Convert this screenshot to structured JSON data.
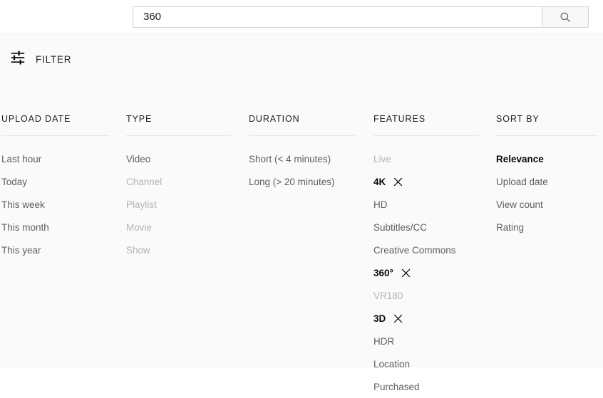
{
  "search": {
    "value": "360",
    "placeholder": "Search",
    "button_label": "Search",
    "icon": "search-icon"
  },
  "filter_bar": {
    "label": "FILTER",
    "icon": "tune-icon"
  },
  "colors": {
    "page_background": "#ffffff",
    "panel_background": "#fafafa",
    "text_default": "#606060",
    "text_selected": "#0a0a0a",
    "text_disabled": "#b4b4b4",
    "divider": "#e8e8e8",
    "input_border": "#d3d3d3",
    "button_background": "#f8f8f8"
  },
  "columns": [
    {
      "header": "UPLOAD DATE",
      "items": [
        {
          "label": "Last hour",
          "state": "default",
          "clearable": false
        },
        {
          "label": "Today",
          "state": "default",
          "clearable": false
        },
        {
          "label": "This week",
          "state": "default",
          "clearable": false
        },
        {
          "label": "This month",
          "state": "default",
          "clearable": false
        },
        {
          "label": "This year",
          "state": "default",
          "clearable": false
        }
      ]
    },
    {
      "header": "TYPE",
      "items": [
        {
          "label": "Video",
          "state": "default",
          "clearable": false
        },
        {
          "label": "Channel",
          "state": "disabled",
          "clearable": false
        },
        {
          "label": "Playlist",
          "state": "disabled",
          "clearable": false
        },
        {
          "label": "Movie",
          "state": "disabled",
          "clearable": false
        },
        {
          "label": "Show",
          "state": "disabled",
          "clearable": false
        }
      ]
    },
    {
      "header": "DURATION",
      "items": [
        {
          "label": "Short (< 4 minutes)",
          "state": "default",
          "clearable": false
        },
        {
          "label": "Long (> 20 minutes)",
          "state": "default",
          "clearable": false
        }
      ]
    },
    {
      "header": "FEATURES",
      "items": [
        {
          "label": "Live",
          "state": "disabled",
          "clearable": false
        },
        {
          "label": "4K",
          "state": "selected",
          "clearable": true
        },
        {
          "label": "HD",
          "state": "default",
          "clearable": false
        },
        {
          "label": "Subtitles/CC",
          "state": "default",
          "clearable": false
        },
        {
          "label": "Creative Commons",
          "state": "default",
          "clearable": false
        },
        {
          "label": "360°",
          "state": "selected",
          "clearable": true
        },
        {
          "label": "VR180",
          "state": "disabled",
          "clearable": false
        },
        {
          "label": "3D",
          "state": "selected",
          "clearable": true
        },
        {
          "label": "HDR",
          "state": "default",
          "clearable": false
        },
        {
          "label": "Location",
          "state": "default",
          "clearable": false
        },
        {
          "label": "Purchased",
          "state": "default",
          "clearable": false
        }
      ]
    },
    {
      "header": "SORT BY",
      "items": [
        {
          "label": "Relevance",
          "state": "selected",
          "clearable": false
        },
        {
          "label": "Upload date",
          "state": "default",
          "clearable": false
        },
        {
          "label": "View count",
          "state": "default",
          "clearable": false
        },
        {
          "label": "Rating",
          "state": "default",
          "clearable": false
        }
      ]
    }
  ]
}
